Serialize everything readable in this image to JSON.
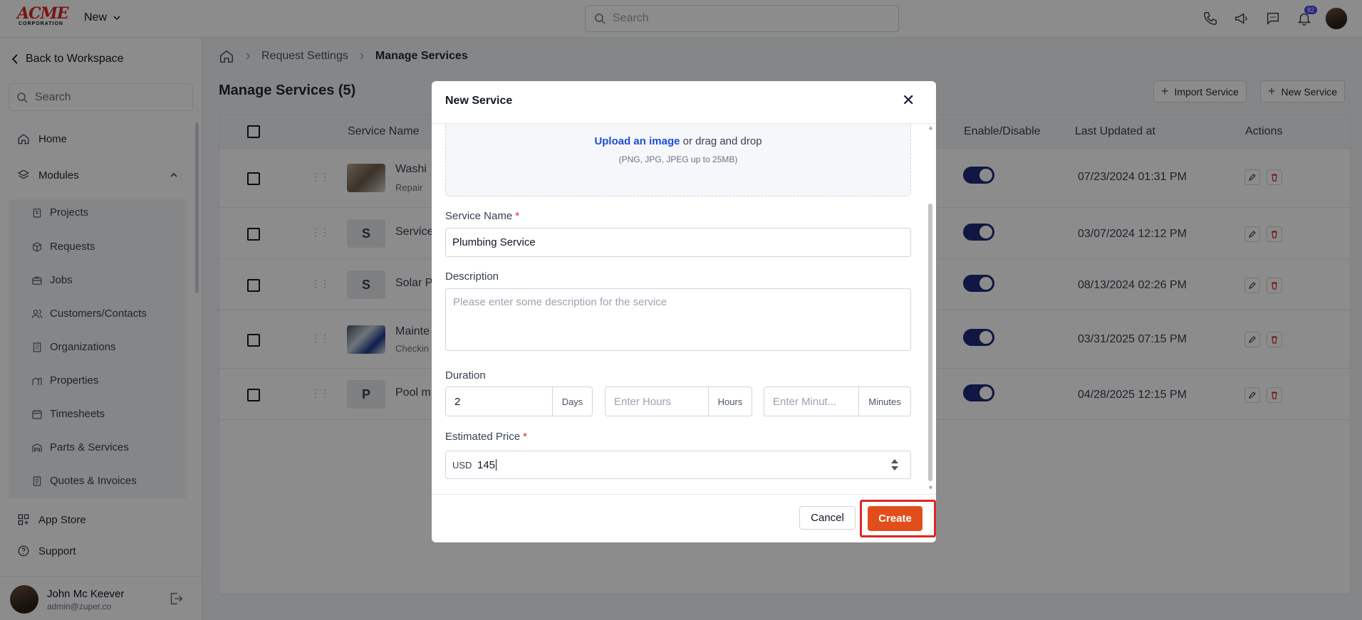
{
  "topbar": {
    "logo_text": "ACME",
    "logo_subtext": "CORPORATION",
    "new_label": "New",
    "search_placeholder": "Search",
    "notification_count": "82"
  },
  "sidebar": {
    "back_label": "Back to Workspace",
    "search_placeholder": "Search",
    "home_label": "Home",
    "modules_label": "Modules",
    "module_items": [
      "Projects",
      "Requests",
      "Jobs",
      "Customers/Contacts",
      "Organizations",
      "Properties",
      "Timesheets",
      "Parts & Services",
      "Quotes & Invoices"
    ],
    "app_store_label": "App Store",
    "support_label": "Support",
    "user": {
      "name": "John Mc Keever",
      "email": "admin@zuper.co"
    }
  },
  "breadcrumb": {
    "level1": "Request Settings",
    "current": "Manage Services"
  },
  "page": {
    "title": "Manage Services (5)",
    "import_label": "Import Service",
    "new_label": "New Service"
  },
  "table": {
    "headers": {
      "service_name": "Service Name",
      "enable": "Enable/Disable",
      "updated": "Last Updated at",
      "actions": "Actions"
    },
    "rows": [
      {
        "name": "Washi",
        "sub": "Repair",
        "initial": "",
        "date": "07/23/2024 01:31 PM",
        "enabled": true
      },
      {
        "name": "Service",
        "sub": "",
        "initial": "S",
        "date": "03/07/2024 12:12 PM",
        "enabled": true
      },
      {
        "name": "Solar P",
        "sub": "",
        "initial": "S",
        "date": "08/13/2024 02:26 PM",
        "enabled": true
      },
      {
        "name": "Mainte",
        "sub": "Checkin",
        "initial": "",
        "date": "03/31/2025 07:15 PM",
        "enabled": true
      },
      {
        "name": "Pool m",
        "sub": "",
        "initial": "P",
        "date": "04/28/2025 12:15 PM",
        "enabled": true
      }
    ]
  },
  "modal": {
    "title": "New Service",
    "upload_link": "Upload an image",
    "upload_text": " or drag and drop",
    "upload_hint": "(PNG, JPG, JPEG up to 25MB)",
    "service_name_label": "Service Name",
    "service_name_value": "Plumbing Service",
    "description_label": "Description",
    "description_placeholder": "Please enter some description for the service",
    "duration_label": "Duration",
    "days_value": "2",
    "days_unit": "Days",
    "hours_placeholder": "Enter Hours",
    "hours_unit": "Hours",
    "minutes_placeholder": "Enter Minut...",
    "minutes_unit": "Minutes",
    "price_label": "Estimated Price",
    "currency": "USD",
    "price_value": "145",
    "cancel_label": "Cancel",
    "create_label": "Create"
  },
  "colors": {
    "primary": "#e24e1b",
    "toggle": "#1e2a78",
    "highlight": "#dc2626"
  }
}
